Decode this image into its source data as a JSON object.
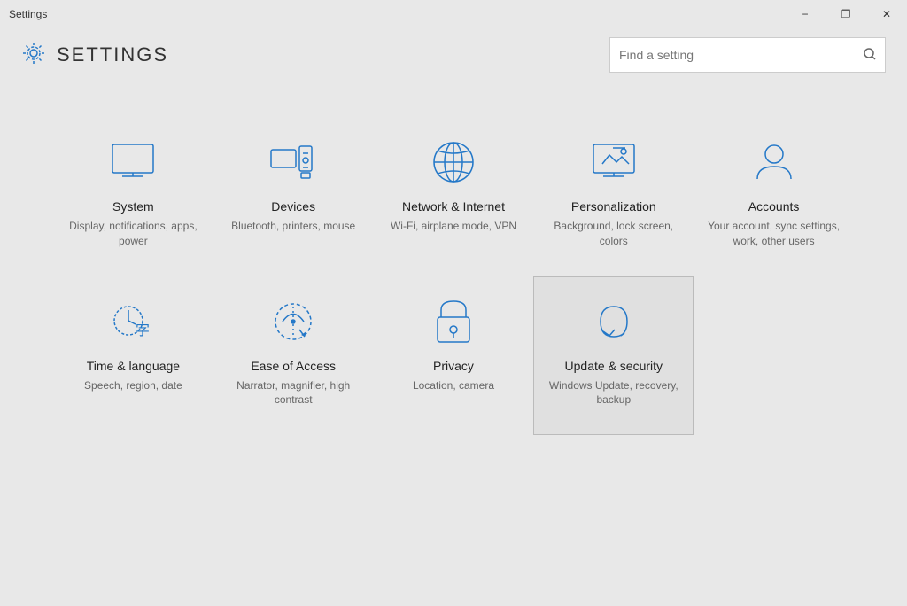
{
  "titlebar": {
    "title": "Settings",
    "minimize": "−",
    "maximize": "❐",
    "close": "✕"
  },
  "header": {
    "title": "SETTINGS",
    "search_placeholder": "Find a setting"
  },
  "items": [
    {
      "id": "system",
      "title": "System",
      "desc": "Display, notifications, apps, power",
      "icon": "system"
    },
    {
      "id": "devices",
      "title": "Devices",
      "desc": "Bluetooth, printers, mouse",
      "icon": "devices"
    },
    {
      "id": "network",
      "title": "Network & Internet",
      "desc": "Wi-Fi, airplane mode, VPN",
      "icon": "network"
    },
    {
      "id": "personalization",
      "title": "Personalization",
      "desc": "Background, lock screen, colors",
      "icon": "personalization"
    },
    {
      "id": "accounts",
      "title": "Accounts",
      "desc": "Your account, sync settings, work, other users",
      "icon": "accounts"
    },
    {
      "id": "time",
      "title": "Time & language",
      "desc": "Speech, region, date",
      "icon": "time"
    },
    {
      "id": "ease",
      "title": "Ease of Access",
      "desc": "Narrator, magnifier, high contrast",
      "icon": "ease"
    },
    {
      "id": "privacy",
      "title": "Privacy",
      "desc": "Location, camera",
      "icon": "privacy"
    },
    {
      "id": "update",
      "title": "Update & security",
      "desc": "Windows Update, recovery, backup",
      "icon": "update",
      "highlighted": true
    }
  ]
}
